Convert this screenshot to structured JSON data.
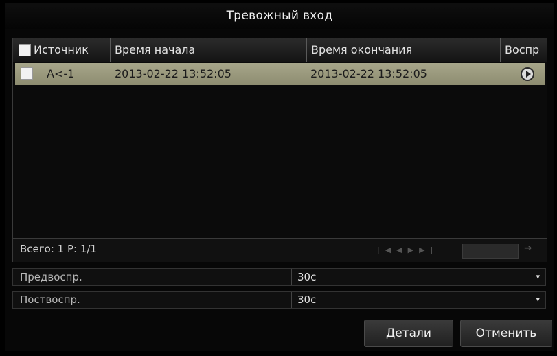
{
  "window": {
    "title": "Тревожный вход"
  },
  "table": {
    "columns": [
      "Источник",
      "Время начала",
      "Время окончания",
      "Воспр"
    ],
    "rows": [
      {
        "source": "A<-1",
        "start": "2013-02-22 13:52:05",
        "end": "2013-02-22 13:52:05",
        "play_icon": "play-circle-icon"
      }
    ],
    "footer": {
      "total": "Всего: 1  P: 1/1"
    }
  },
  "settings": [
    {
      "label": "Предвоспр.",
      "value": "30с"
    },
    {
      "label": "Поствоспр.",
      "value": "30с"
    }
  ],
  "buttons": {
    "details": "Детали",
    "cancel": "Отменить"
  },
  "colors": {
    "selected_row": "#a09f83",
    "background": "#000000"
  }
}
